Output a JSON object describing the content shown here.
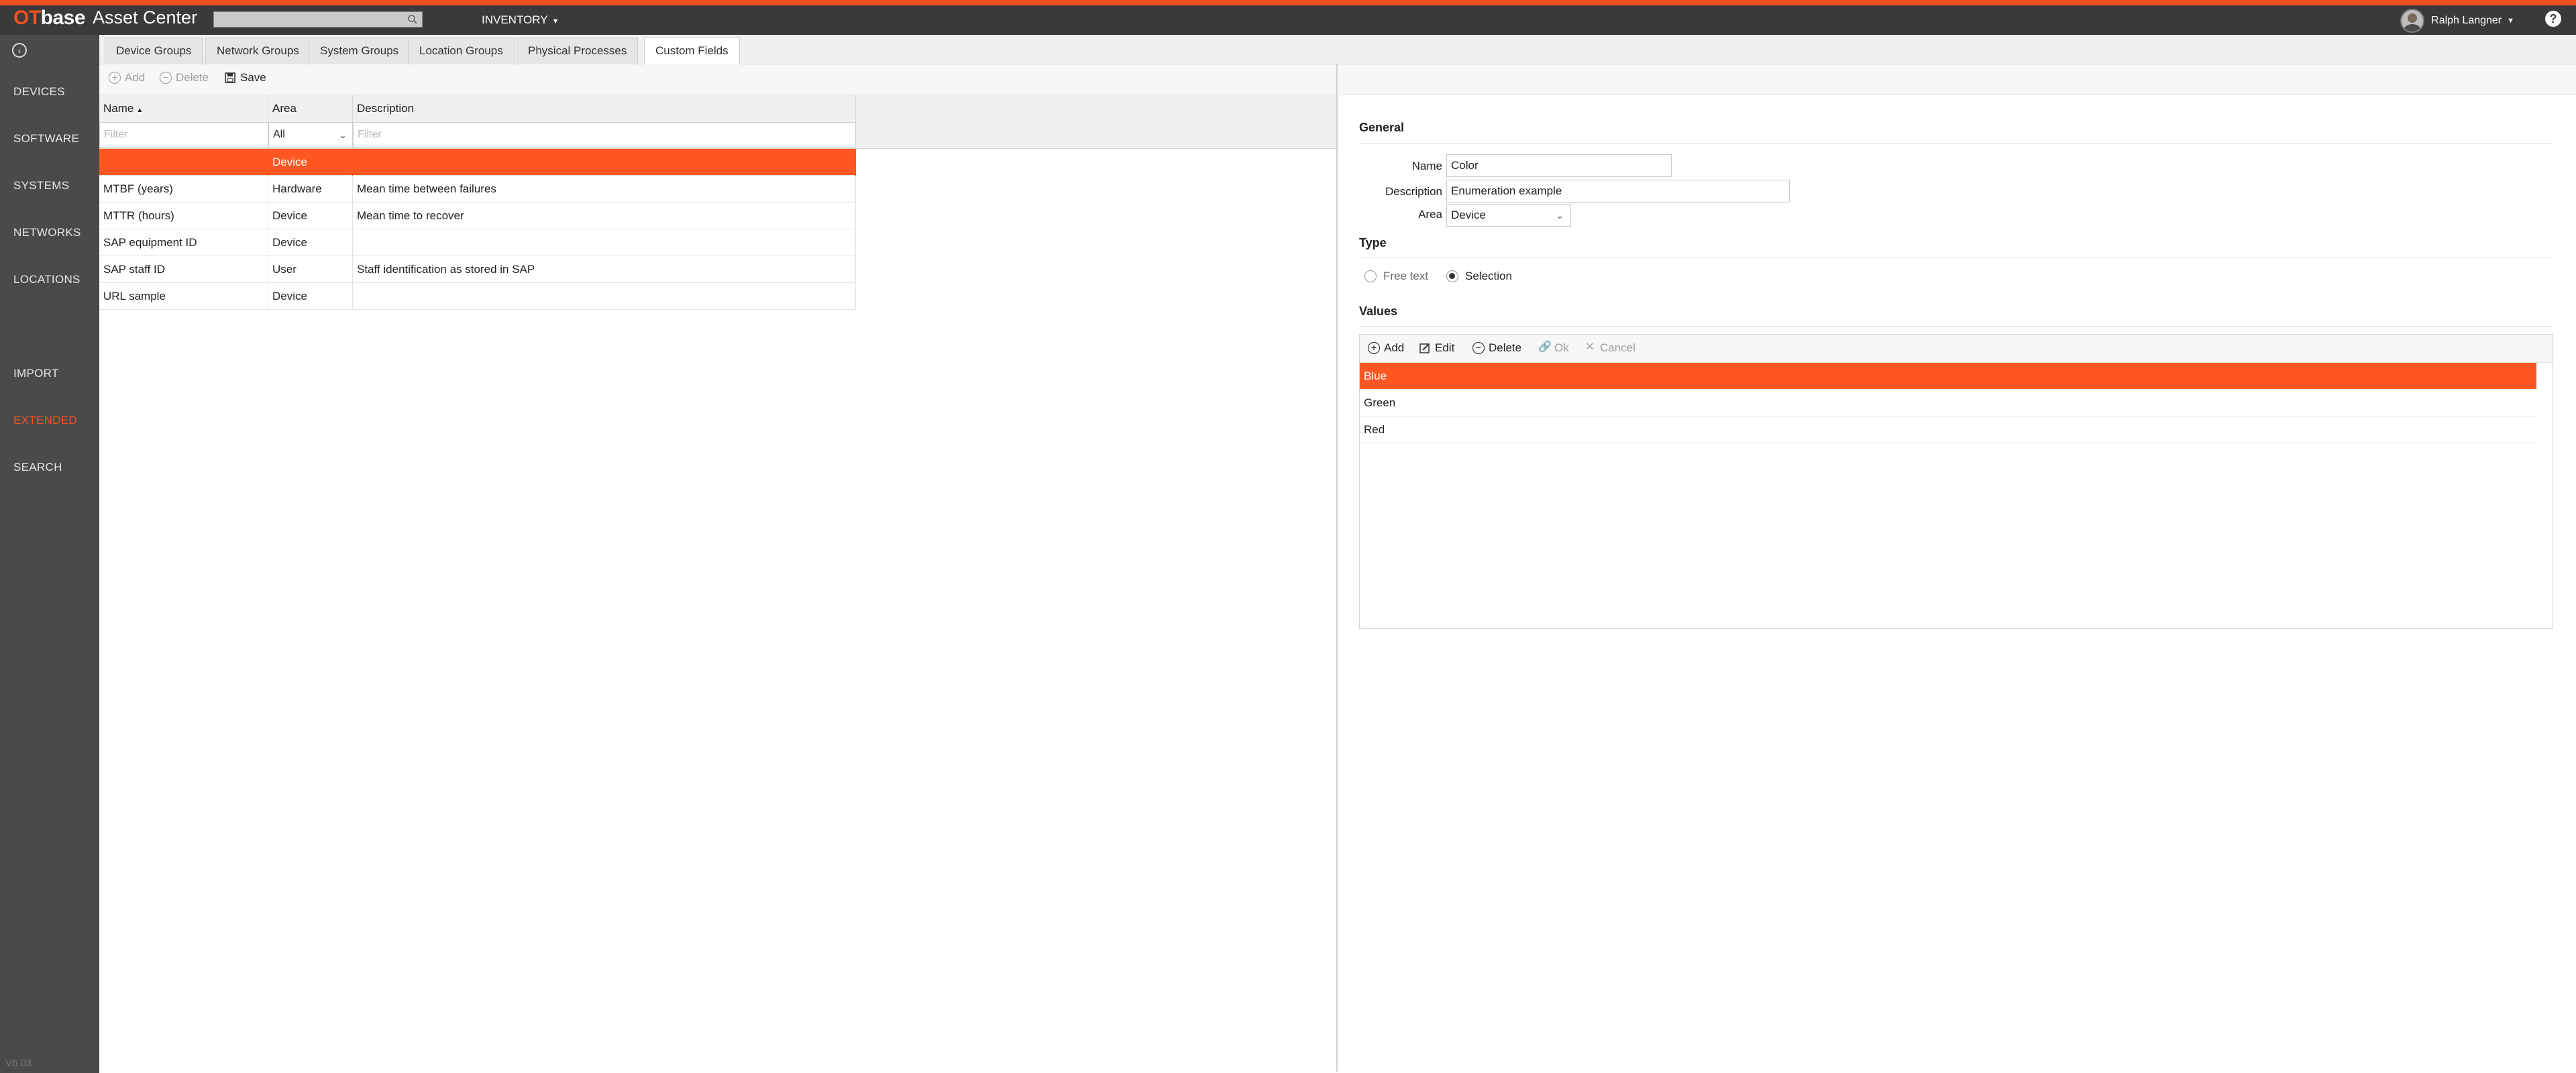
{
  "header": {
    "brand_ot": "OT",
    "brand_base": "base",
    "app_title": "Asset Center",
    "search_placeholder": "",
    "nav_menu": "INVENTORY",
    "user_name": "Ralph Langner",
    "help": "?"
  },
  "sidebar": {
    "items": [
      {
        "label": "DEVICES"
      },
      {
        "label": "SOFTWARE"
      },
      {
        "label": "SYSTEMS"
      },
      {
        "label": "NETWORKS"
      },
      {
        "label": "LOCATIONS"
      },
      {
        "label": "IMPORT"
      },
      {
        "label": "EXTENDED",
        "active": true
      },
      {
        "label": "SEARCH"
      }
    ],
    "version": "V6.03"
  },
  "tabs": [
    {
      "label": "Device Groups"
    },
    {
      "label": "Network Groups"
    },
    {
      "label": "System Groups"
    },
    {
      "label": "Location Groups"
    },
    {
      "label": "Physical Processes"
    },
    {
      "label": "Custom Fields",
      "active": true
    }
  ],
  "toolbar": {
    "add": "Add",
    "delete": "Delete",
    "save": "Save"
  },
  "grid": {
    "columns": [
      "Name",
      "Area",
      "Description"
    ],
    "filter_name_placeholder": "Filter",
    "filter_area_value": "All",
    "filter_desc_placeholder": "Filter",
    "rows": [
      {
        "name": "",
        "area": "Device",
        "description": ""
      },
      {
        "name": "MTBF (years)",
        "area": "Hardware",
        "description": "Mean time between failures"
      },
      {
        "name": "MTTR (hours)",
        "area": "Device",
        "description": "Mean time to recover"
      },
      {
        "name": "SAP equipment ID",
        "area": "Device",
        "description": ""
      },
      {
        "name": "SAP staff ID",
        "area": "User",
        "description": "Staff identification as stored in SAP"
      },
      {
        "name": "URL sample",
        "area": "Device",
        "description": ""
      }
    ]
  },
  "detail": {
    "general_title": "General",
    "name_label": "Name",
    "name_value": "Color",
    "description_label": "Description",
    "description_value": "Enumeration example",
    "area_label": "Area",
    "area_value": "Device",
    "type_title": "Type",
    "type_free_text": "Free text",
    "type_selection": "Selection",
    "values_title": "Values",
    "values_toolbar": {
      "add": "Add",
      "edit": "Edit",
      "delete": "Delete",
      "ok": "Ok",
      "cancel": "Cancel"
    },
    "values": [
      "Blue",
      "Green",
      "Red"
    ]
  },
  "colors": {
    "accent": "#ff5722",
    "topbar": "#3a3a3a",
    "sidebar": "#4a4a4a"
  }
}
